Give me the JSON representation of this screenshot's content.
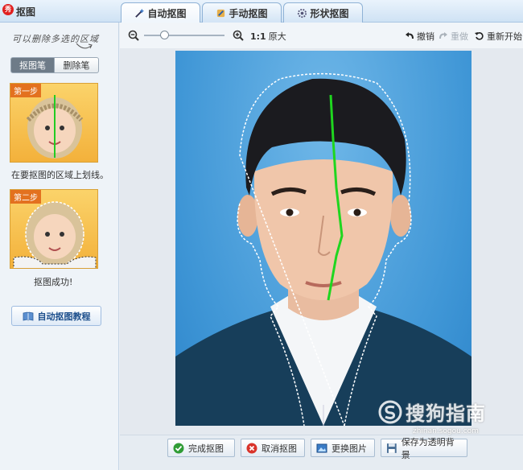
{
  "titlebar": {
    "title": "抠图",
    "icon": "app-logo-icon",
    "icon_text": "秀"
  },
  "tabs": [
    {
      "label": "自动抠图",
      "icon": "magic-wand-icon",
      "active": true
    },
    {
      "label": "手动抠图",
      "icon": "hand-pen-icon",
      "active": false
    },
    {
      "label": "形状抠图",
      "icon": "gear-shape-icon",
      "active": false
    }
  ],
  "left": {
    "hint": "可以删除多选的区域",
    "modes": {
      "active": "抠图笔",
      "inactive": "删除笔"
    },
    "step1": {
      "label": "第一步",
      "caption": "在要抠图的区域上划线。"
    },
    "step2": {
      "label": "第二步",
      "caption": "抠图成功!"
    },
    "tutorial": "自动抠图教程"
  },
  "toolbar": {
    "zoom_ratio": "1:1",
    "zoom_label": "原大",
    "undo": "撤销",
    "redo": "重做",
    "restart": "重新开始",
    "slider_value": 0.25
  },
  "bottom": {
    "finish": "完成抠图",
    "cancel": "取消抠图",
    "replace": "更换图片",
    "save": "保存为透明背景"
  },
  "watermark": {
    "text": "搜狗指南",
    "sub": "zhinan.sogou.com"
  },
  "colors": {
    "accent": "#2e86cb",
    "stroke": "#22dd22",
    "step_orange": "#f3b13b"
  }
}
